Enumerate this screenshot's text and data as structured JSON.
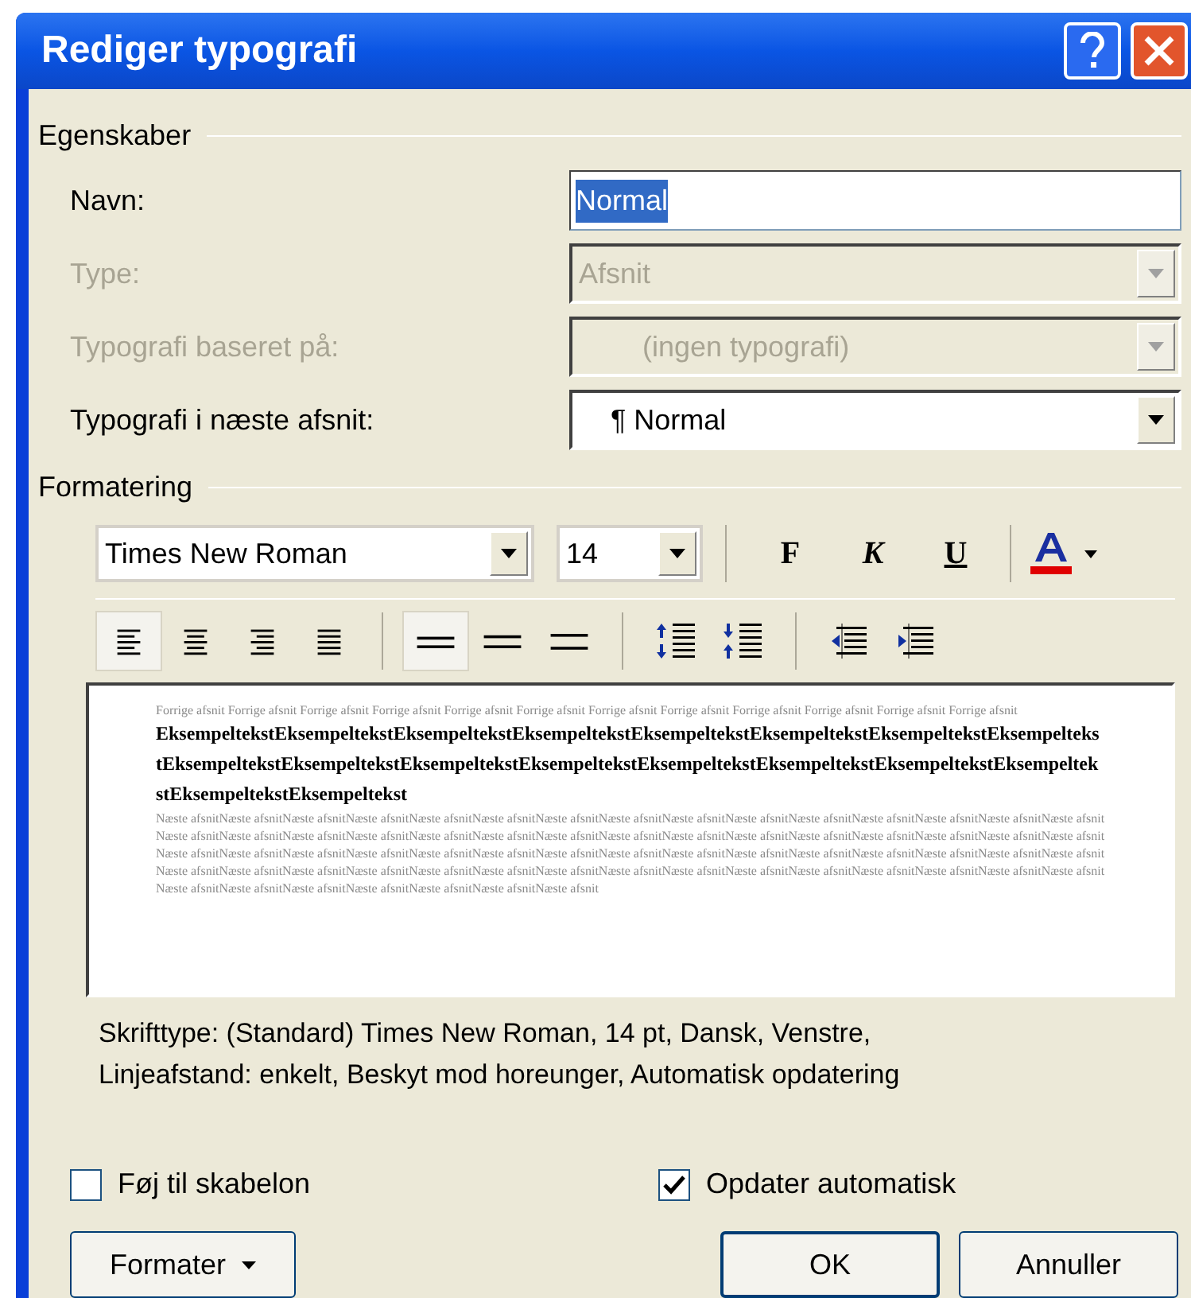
{
  "window": {
    "title": "Rediger typografi"
  },
  "properties": {
    "heading": "Egenskaber",
    "rows": [
      {
        "label": "Navn:",
        "kind": "text",
        "value": "Normal",
        "disabled": false
      },
      {
        "label": "Type:",
        "kind": "dropdown",
        "value": "Afsnit",
        "disabled": true
      },
      {
        "label": "Typografi baseret på:",
        "kind": "dropdown",
        "value": "(ingen typografi)",
        "disabled": true
      },
      {
        "label": "Typografi i næste afsnit:",
        "kind": "dropdown",
        "value": "¶ Normal",
        "disabled": false
      }
    ]
  },
  "formatting": {
    "heading": "Formatering",
    "font": "Times New Roman",
    "size": "14",
    "styles": [
      {
        "kind": "bold",
        "label": "F",
        "selected": false
      },
      {
        "kind": "italic",
        "label": "K",
        "selected": false
      },
      {
        "kind": "underline",
        "label": "U",
        "selected": false
      }
    ],
    "font_color": {
      "color": "#e00000"
    },
    "alignment": [
      {
        "kind": "left",
        "selected": true
      },
      {
        "kind": "center",
        "selected": false
      },
      {
        "kind": "right",
        "selected": false
      },
      {
        "kind": "justify",
        "selected": false
      }
    ],
    "spacing": [
      {
        "kind": "single",
        "selected": true
      },
      {
        "kind": "onehalf",
        "selected": false
      },
      {
        "kind": "double",
        "selected": false
      }
    ],
    "paragraph_spacing": [
      {
        "kind": "increase"
      },
      {
        "kind": "decrease"
      }
    ],
    "indent": [
      {
        "kind": "decrease"
      },
      {
        "kind": "increase"
      }
    ]
  },
  "preview": {
    "previous": "Forrige afsnit Forrige afsnit Forrige afsnit Forrige afsnit Forrige afsnit Forrige afsnit Forrige afsnit Forrige afsnit Forrige afsnit Forrige afsnit Forrige afsnit Forrige afsnit",
    "sample": "EksempeltekstEksempeltekstEksempeltekstEksempeltekstEksempeltekstEksempeltekstEksempeltekstEksempeltekstEksempeltekstEksempeltekstEksempeltekstEksempeltekstEksempeltekstEksempeltekstEksempeltekstEksempeltekstEksempeltekstEksempeltekst",
    "next": "Næste afsnitNæste afsnitNæste afsnitNæste afsnitNæste afsnitNæste afsnitNæste afsnitNæste afsnitNæste afsnitNæste afsnitNæste afsnitNæste afsnitNæste afsnitNæste afsnitNæste afsnitNæste afsnitNæste afsnitNæste afsnitNæste afsnitNæste afsnitNæste afsnitNæste afsnitNæste afsnitNæste afsnitNæste afsnitNæste afsnitNæste afsnitNæste afsnitNæste afsnitNæste afsnitNæste afsnitNæste afsnitNæste afsnitNæste afsnitNæste afsnitNæste afsnitNæste afsnitNæste afsnitNæste afsnitNæste afsnitNæste afsnitNæste afsnitNæste afsnitNæste afsnitNæste afsnitNæste afsnitNæste afsnitNæste afsnitNæste afsnitNæste afsnitNæste afsnitNæste afsnitNæste afsnitNæste afsnitNæste afsnitNæste afsnitNæste afsnitNæste afsnitNæste afsnitNæste afsnitNæste afsnitNæste afsnitNæste afsnitNæste afsnitNæste afsnitNæste afsnitNæste afsnit"
  },
  "description": "Skrifttype: (Standard) Times New Roman, 14 pt, Dansk, Venstre,\nLinjeafstand:  enkelt, Beskyt mod horeunger, Automatisk opdatering",
  "checkboxes": [
    {
      "label": "Føj til skabelon",
      "checked": false
    },
    {
      "label": "Opdater automatisk",
      "checked": true
    }
  ],
  "buttons": {
    "menu": "Formater",
    "ok": "OK",
    "cancel": "Annuller"
  }
}
